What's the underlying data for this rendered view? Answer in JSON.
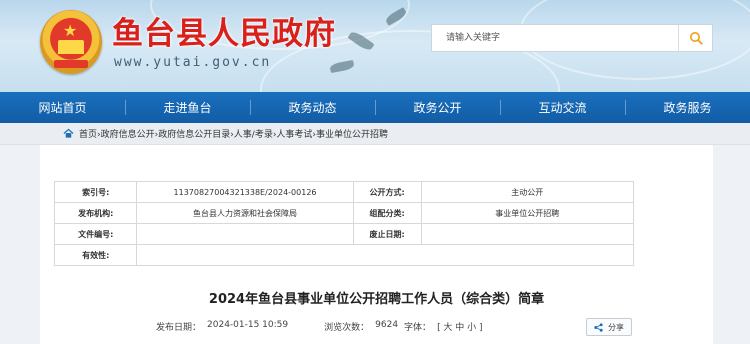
{
  "header": {
    "site_title": "鱼台县人民政府",
    "site_url": "www.yutai.gov.cn",
    "search_placeholder": "请输入关键字"
  },
  "nav": {
    "items": [
      "网站首页",
      "走进鱼台",
      "政务动态",
      "政务公开",
      "互动交流",
      "政务服务"
    ]
  },
  "breadcrumb": {
    "path": "首页›政府信息公开›政府信息公开目录›人事/考录›人事考试›事业单位公开招聘"
  },
  "info_table": {
    "index_label": "索引号:",
    "index_value": "11370827004321338E/2024-00126",
    "method_label": "公开方式:",
    "method_value": "主动公开",
    "issuer_label": "发布机构:",
    "issuer_value": "鱼台县人力资源和社会保障局",
    "category_label": "组配分类:",
    "category_value": "事业单位公开招聘",
    "docno_label": "文件编号:",
    "docno_value": "",
    "abolish_label": "废止日期:",
    "abolish_value": "",
    "validity_label": "有效性:",
    "validity_value": ""
  },
  "article": {
    "title": "2024年鱼台县事业单位公开招聘工作人员（综合类）简章",
    "date_label": "发布日期：",
    "date_value": "2024-01-15 10:59",
    "views_label": "浏览次数：",
    "views_value": "9624",
    "font_label": "字体：",
    "font_options": "[ 大 中 小 ]",
    "share_label": "分享"
  },
  "colors": {
    "title_red": "#d9201a",
    "nav_blue": "#1668b3"
  }
}
